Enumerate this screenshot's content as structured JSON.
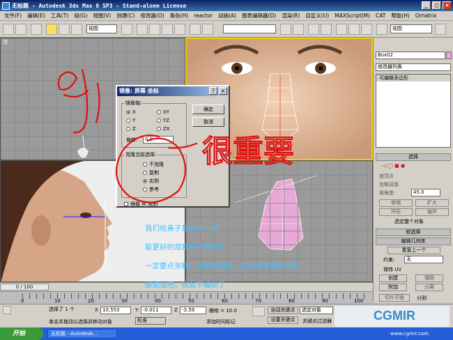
{
  "window": {
    "title": "无标题 - Autodesk 3ds Max 8 SP3 - Stand-alone License",
    "minimize_glyph": "_",
    "maximize_glyph": "□",
    "close_glyph": "×"
  },
  "menu": [
    "文件(F)",
    "编辑(E)",
    "工具(T)",
    "组(G)",
    "视图(V)",
    "创建(C)",
    "修改器(O)",
    "角色(H)",
    "reactor",
    "动画(A)",
    "图表编辑器(D)",
    "渲染(R)",
    "自定义(U)",
    "MAXScript(M)",
    "CAT",
    "帮助(H)",
    "Ornatrix"
  ],
  "toolbar": {
    "ref_coord_label": "视图",
    "view_select_label": "视图"
  },
  "viewports": {
    "top_left_label": "顶",
    "front_label": "前",
    "left_label": "左",
    "perspective_label": "透视"
  },
  "command_panel": {
    "object_name": "Box02",
    "modifier_list": "修改器列表",
    "stack_item": "可编辑多边形",
    "selection_rollout": "选择",
    "by_vertex": "按顶点",
    "ignore_backfacing": "忽略背面",
    "by_angle": "按角度:",
    "angle_value": "45.0",
    "shrink": "收缩",
    "grow": "扩大",
    "ring": "环形",
    "loop": "循环",
    "selected_count": "选定整个对象",
    "soft_selection_rollout": "软选择",
    "edit_geometry_rollout": "编辑几何体",
    "repeat_last": "重复上一个",
    "constraint_label": "约束:",
    "constraint_value": "无",
    "preserve_uv": "保持 UV",
    "create": "创建",
    "collapse": "塌陷",
    "attach": "附加",
    "detach": "分离",
    "slice_plane": "切片平面",
    "split": "分割"
  },
  "dialog": {
    "title": "镜像: 屏幕 坐标",
    "help_glyph": "?",
    "close_glyph": "×",
    "axis_group": "镜像轴:",
    "axes": [
      "X",
      "Y",
      "Z",
      "XY",
      "YZ",
      "ZX"
    ],
    "offset_label": "偏移:",
    "offset_value": "0.0",
    "clone_group": "克隆当前选择:",
    "clone_options": [
      "不克隆",
      "复制",
      "实例",
      "参考"
    ],
    "mirror_ik": "镜像 IK 限制",
    "ok": "确定",
    "cancel": "取消"
  },
  "annotation": {
    "handwritten_1": "很重要",
    "handwritten_2": "JJ"
  },
  "captions": [
    "我们给鼻子复制另一面",
    "能更好的观察鼻子的形状",
    "一定要点关联，也就是实例，它的意思我想大家",
    "都知道吧，我就不细说了"
  ],
  "timeline": {
    "frame_counter": "0 / 100",
    "ticks": [
      "0",
      "10",
      "20",
      "30",
      "40",
      "50",
      "60",
      "70",
      "80",
      "90",
      "100"
    ]
  },
  "status": {
    "selected": "选择了 1 个",
    "x_label": "X",
    "x_value": "10.553",
    "y_label": "Y",
    "y_value": "-0.011",
    "z_label": "Z",
    "z_value": "-3.59",
    "grid_label": "栅格 = 10.0",
    "auto_key": "自动关键点",
    "selected_objects": "选定对象",
    "set_key": "设置关键点",
    "key_filters": "关键点过滤器",
    "prompt": "单击并拖动以选择并移动对象",
    "add_time_tag": "添加时间标记",
    "standard": "标准"
  },
  "taskbar": {
    "start": "开始",
    "item1": "无标题 - Autodesk...",
    "tray": "www.cgmir.com"
  },
  "watermark": "CGMIR"
}
